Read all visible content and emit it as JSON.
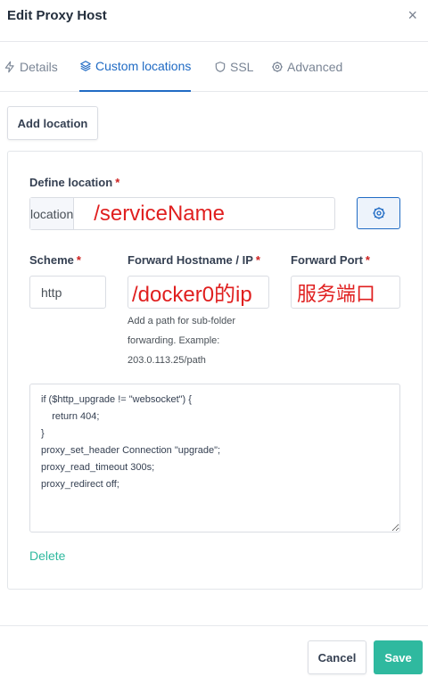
{
  "modal": {
    "title": "Edit Proxy Host",
    "close_glyph": "×"
  },
  "tabs": [
    {
      "label": "Details",
      "icon": "lightning-icon"
    },
    {
      "label": "Custom locations",
      "icon": "layers-icon",
      "active": true
    },
    {
      "label": "SSL",
      "icon": "shield-icon"
    },
    {
      "label": "Advanced",
      "icon": "gear-icon"
    }
  ],
  "add_location_label": "Add location",
  "location": {
    "define_label": "Define location",
    "required_mark": "*",
    "prefix": "location",
    "value": "/serviceName",
    "settings_icon": "gear-icon"
  },
  "forward": {
    "scheme_label": "Scheme",
    "scheme_value": "http",
    "host_label": "Forward Hostname / IP",
    "host_value": "/docker0的ip",
    "port_label": "Forward Port",
    "port_value": "服务端口",
    "hint": "Add a path for sub-folder forwarding. Example: 203.0.113.25/path"
  },
  "advanced_config": "if ($http_upgrade != \"websocket\") {\n    return 404;\n}\nproxy_set_header Connection \"upgrade\";\nproxy_read_timeout 300s;\nproxy_redirect off;",
  "delete_label": "Delete",
  "footer": {
    "cancel_label": "Cancel",
    "save_label": "Save"
  },
  "colors": {
    "accent": "#206bc4",
    "teal": "#2fb99f",
    "required": "#cd201f",
    "annotation_red": "#e01f1f"
  }
}
